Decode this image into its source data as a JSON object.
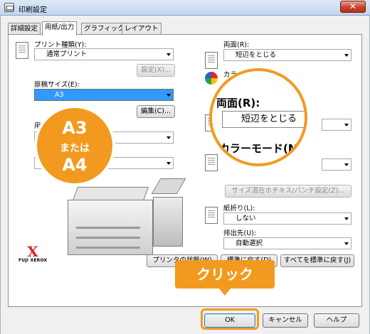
{
  "window": {
    "title": "印刷設定",
    "close_label": "✕"
  },
  "tabs": [
    "詳細設定",
    "用紙/出力",
    "グラフィックス",
    "レイアウト"
  ],
  "left": {
    "print_type_label": "プリント種類(Y):",
    "print_type_value": "通常プリント",
    "settings_button": "設定(X)...",
    "paper_size_label": "原稿サイズ(E):",
    "paper_size_value": "A3",
    "edit_button": "編集(C)...",
    "paper_label": "用紙",
    "paper_value": "",
    "brand_logo": "X",
    "brand_text": "FUJI XEROX"
  },
  "right": {
    "duplex_label": "両面(R):",
    "duplex_value": "短辺をとじる",
    "color_label": "カラー",
    "color_value": "",
    "mixed_button": "サイズ混在ホチキス/パンチ設定(Z)...",
    "fold_label": "紙折り(L):",
    "fold_value": "しない",
    "output_label": "排出先(U):",
    "output_value": "自動選択"
  },
  "row_buttons": {
    "printer_status": "プリンタの状態(W)",
    "reset_standard": "標準に戻す(D)",
    "reset_all": "すべてを標準に戻す(J)"
  },
  "footer": {
    "ok": "OK",
    "cancel": "キャンセル",
    "help": "ヘルプ"
  },
  "annotations": {
    "size_line1": "A3",
    "size_line2": "または",
    "size_line3": "A4",
    "zoom_duplex_label": "両面(R):",
    "zoom_duplex_value": "短辺をとじる",
    "zoom_color_label": "カラーモード(M):",
    "click_label": "クリック",
    "accent_color": "#f29a1f"
  }
}
